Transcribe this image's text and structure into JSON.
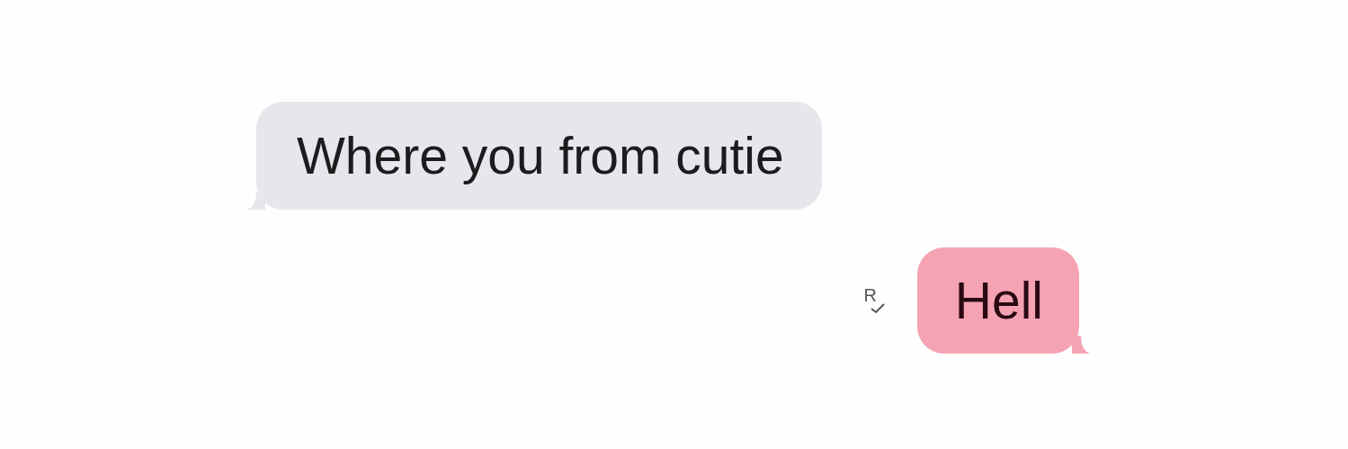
{
  "messages": [
    {
      "kind": "incoming",
      "text": "Where you from cutie"
    },
    {
      "kind": "outgoing",
      "text": "Hell",
      "receipt": "R"
    }
  ]
}
